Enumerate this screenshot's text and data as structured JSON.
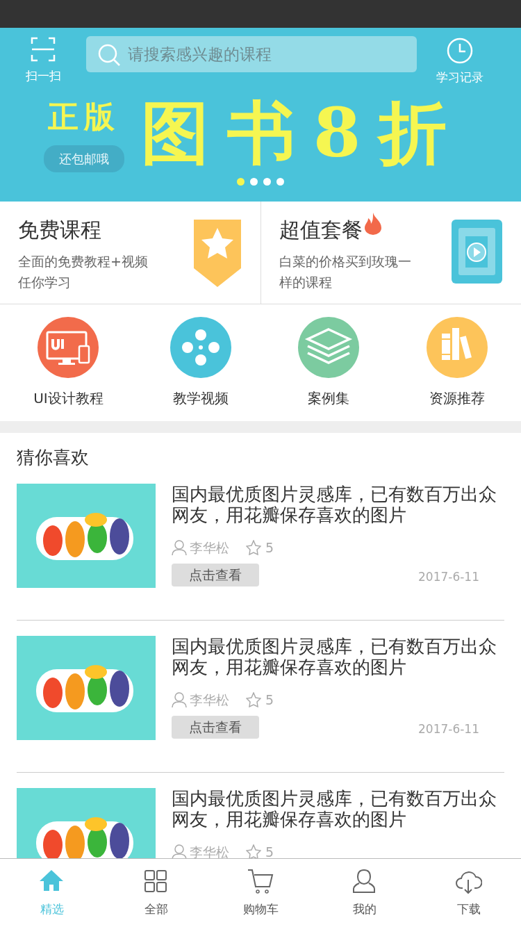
{
  "header": {
    "scan_label": "扫一扫",
    "search": {
      "placeholder": "请搜索感兴趣的课程"
    },
    "history_label": "学习记录"
  },
  "banner": {
    "tag": "正版",
    "badge": "还包邮哦",
    "headline": "图书8折",
    "dots": [
      {
        "selected": true
      },
      {
        "selected": false
      },
      {
        "selected": false
      },
      {
        "selected": false
      }
    ]
  },
  "promos": [
    {
      "kind": "free",
      "title": "免费课程",
      "hot": false,
      "text": "全面的免费教程+视频任你学习"
    },
    {
      "kind": "bundle",
      "title": "超值套餐",
      "hot": true,
      "text": "白菜的价格买到玫瑰一样的课程"
    }
  ],
  "categories": [
    {
      "kind": "ui",
      "label": "UI设计教程",
      "color": "#f26b4b"
    },
    {
      "kind": "video",
      "label": "教学视频",
      "color": "#4ac3da"
    },
    {
      "kind": "cases",
      "label": "案例集",
      "color": "#7ccba0"
    },
    {
      "kind": "resources",
      "label": "资源推荐",
      "color": "#fdc45a"
    }
  ],
  "recommend": {
    "title": "猜你喜欢",
    "items": [
      {
        "kind": "picture",
        "title": "国内最优质图片灵感库，已有数百万出众网友，用花瓣保存喜欢的图片",
        "author": "李华松",
        "rating": "5",
        "button": "点击查看",
        "date": "2017-6-11"
      },
      {
        "kind": "picture",
        "title": "国内最优质图片灵感库，已有数百万出众网友，用花瓣保存喜欢的图片",
        "author": "李华松",
        "rating": "5",
        "button": "点击查看",
        "date": "2017-6-11"
      },
      {
        "kind": "picture",
        "title": "国内最优质图片灵感库，已有数百万出众网友，用花瓣保存喜欢的图片",
        "author": "李华松",
        "rating": "5"
      }
    ]
  },
  "tabs": [
    {
      "kind": "home",
      "label": "精选",
      "selected": true
    },
    {
      "kind": "all",
      "label": "全部",
      "selected": false
    },
    {
      "kind": "cart",
      "label": "购物车",
      "selected": false
    },
    {
      "kind": "me",
      "label": "我的",
      "selected": false
    },
    {
      "kind": "download",
      "label": "下载",
      "selected": false
    }
  ]
}
